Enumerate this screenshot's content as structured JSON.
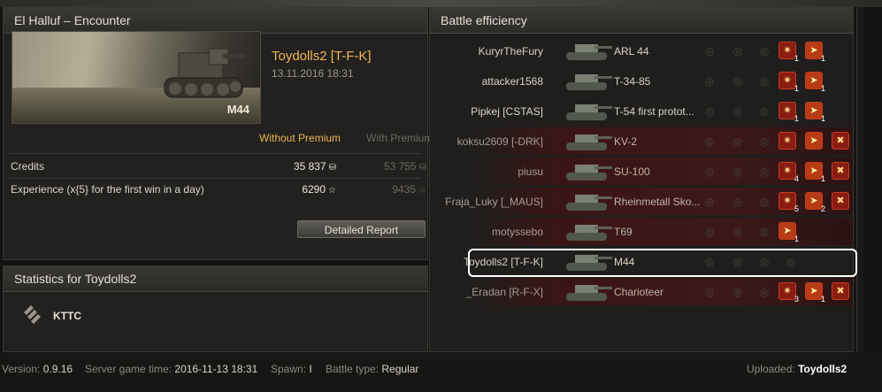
{
  "battle": {
    "title": "El Halluf – Encounter",
    "player": "Toydolls2 [T-F-K]",
    "datetime": "13.11.2016 18:31",
    "tank": "M44"
  },
  "rewards": {
    "without_premium_label": "Without Premium",
    "with_premium_label": "With Premium",
    "rows": [
      {
        "label": "Credits",
        "without": "35 837",
        "with": "53 755",
        "icon": "credits-icon"
      },
      {
        "label": "Experience (x{5} for the first win in a day)",
        "without": "6290",
        "with": "9435",
        "icon": "xp-star-icon"
      }
    ],
    "detailed_report": "Detailed Report"
  },
  "stats": {
    "title": "Statistics for Toydolls2",
    "source": "KTTC"
  },
  "efficiency": {
    "title": "Battle efficiency",
    "highlight_color": "#ffffff",
    "ally_color": "#22211f",
    "enemy_color": "#3d1818",
    "players": [
      {
        "name": "KuryrTheFury",
        "vehicle": "ARL 44",
        "team": "ally",
        "achievements": [
          {
            "icon": "damage-icon",
            "count": "1"
          },
          {
            "icon": "fire-hit-icon",
            "count": "1"
          }
        ]
      },
      {
        "name": "attacker1568",
        "vehicle": "T-34-85",
        "team": "ally",
        "achievements": [
          {
            "icon": "damage-icon",
            "count": "1"
          },
          {
            "icon": "fire-hit-icon",
            "count": "1"
          }
        ]
      },
      {
        "name": "Pipkej [CSTAS]",
        "vehicle": "T-54 first protot...",
        "team": "ally",
        "achievements": [
          {
            "icon": "damage-icon",
            "count": "1"
          },
          {
            "icon": "fire-hit-icon",
            "count": "1"
          }
        ]
      },
      {
        "name": "koksu2609 [-DRK]",
        "vehicle": "KV-2",
        "team": "enemy",
        "achievements": [
          {
            "icon": "damage-icon",
            "count": ""
          },
          {
            "icon": "fire-hit-icon",
            "count": ""
          },
          {
            "icon": "kill-icon",
            "count": ""
          }
        ]
      },
      {
        "name": "piusu",
        "vehicle": "SU-100",
        "team": "enemy",
        "achievements": [
          {
            "icon": "damage-icon",
            "count": "4"
          },
          {
            "icon": "fire-hit-icon",
            "count": "1"
          },
          {
            "icon": "kill-icon",
            "count": ""
          }
        ]
      },
      {
        "name": "Fraja_Luky [_MAUS]",
        "vehicle": "Rheinmetall Sko...",
        "team": "enemy",
        "achievements": [
          {
            "icon": "damage-icon",
            "count": "5"
          },
          {
            "icon": "fire-hit-icon",
            "count": "2"
          },
          {
            "icon": "kill-icon",
            "count": ""
          }
        ]
      },
      {
        "name": "motyssebo",
        "vehicle": "T69",
        "team": "enemy",
        "achievements": [
          {
            "icon": "fire-hit-icon",
            "count": "1"
          }
        ]
      },
      {
        "name": "Toydolls2 [T-F-K]",
        "vehicle": "M44",
        "team": "ally",
        "achievements": []
      },
      {
        "name": "_Eradan [R-F-X]",
        "vehicle": "Charioteer",
        "team": "enemy",
        "achievements": [
          {
            "icon": "damage-icon",
            "count": "3"
          },
          {
            "icon": "fire-hit-icon",
            "count": "1"
          },
          {
            "icon": "kill-icon",
            "count": ""
          }
        ]
      }
    ]
  },
  "footer": {
    "version_label": "Version:",
    "version": "0.9.16",
    "server_time_label": "Server game time:",
    "server_time": "2016-11-13 18:31",
    "spawn_label": "Spawn:",
    "spawn": "I",
    "battle_type_label": "Battle type:",
    "battle_type": "Regular",
    "uploaded_label": "Uploaded:",
    "uploaded": "Toydolls2"
  }
}
